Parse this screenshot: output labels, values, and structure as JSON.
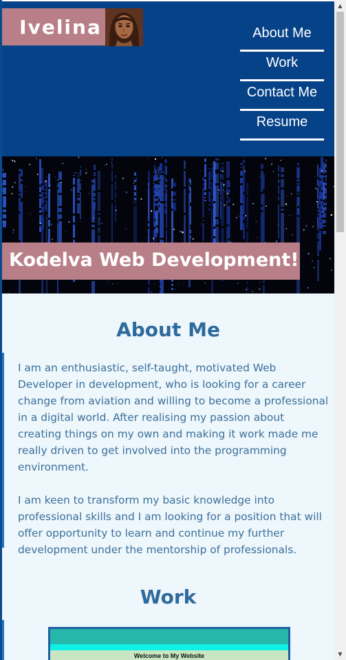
{
  "brand": {
    "name": "Ivelina",
    "avatar_icon": "woman-portrait-icon"
  },
  "nav": {
    "items": [
      {
        "label": "About Me"
      },
      {
        "label": "Work"
      },
      {
        "label": "Contact Me"
      },
      {
        "label": "Resume"
      }
    ]
  },
  "hero": {
    "title": "Kodelva Web Development!"
  },
  "about": {
    "title": "About Me",
    "paragraphs": [
      "I am an enthusiastic, self-taught, motivated Web Developer in development, who is looking for a career change from aviation and willing to become a professional in a digital world. After realising my passion about creating things on my own and making it work made me really driven to get involved into the programming environment.",
      "I am keen to transform my basic knowledge into professional skills and I am looking for a position that will offer opportunity to learn and continue my further development under the mentorship of professionals."
    ]
  },
  "work": {
    "title": "Work",
    "preview_caption": "Welcome to My Website"
  },
  "colors": {
    "header_bg": "#064288",
    "accent_pink": "#b87f89",
    "heading_blue": "#2e6a9b",
    "page_bg": "#eef7fc"
  }
}
